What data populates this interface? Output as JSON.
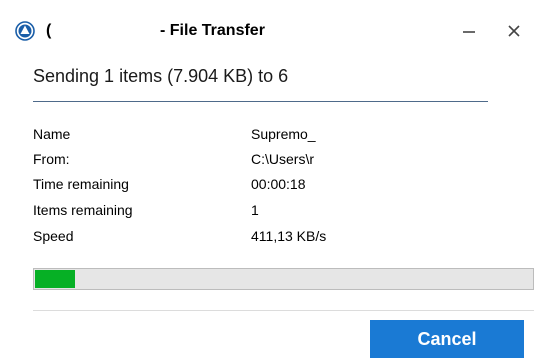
{
  "window": {
    "title_prefix": "(",
    "title": "- File Transfer",
    "accent_color": "#1a7ad4",
    "icons": {
      "app": "supremo-app-icon",
      "minimize": "minimize-icon",
      "close": "close-icon"
    }
  },
  "heading": "Sending 1 items (7.904 KB) to 6",
  "details": [
    {
      "label": "Name",
      "value": "Supremo_"
    },
    {
      "label": "From:",
      "value": "C:\\Users\\r"
    },
    {
      "label": "Time remaining",
      "value": "00:00:18"
    },
    {
      "label": "Items remaining",
      "value": "1"
    },
    {
      "label": "Speed",
      "value": "411,13 KB/s"
    }
  ],
  "progress": {
    "fraction": 0.08,
    "color": "#06b025"
  },
  "buttons": {
    "cancel": "Cancel"
  }
}
